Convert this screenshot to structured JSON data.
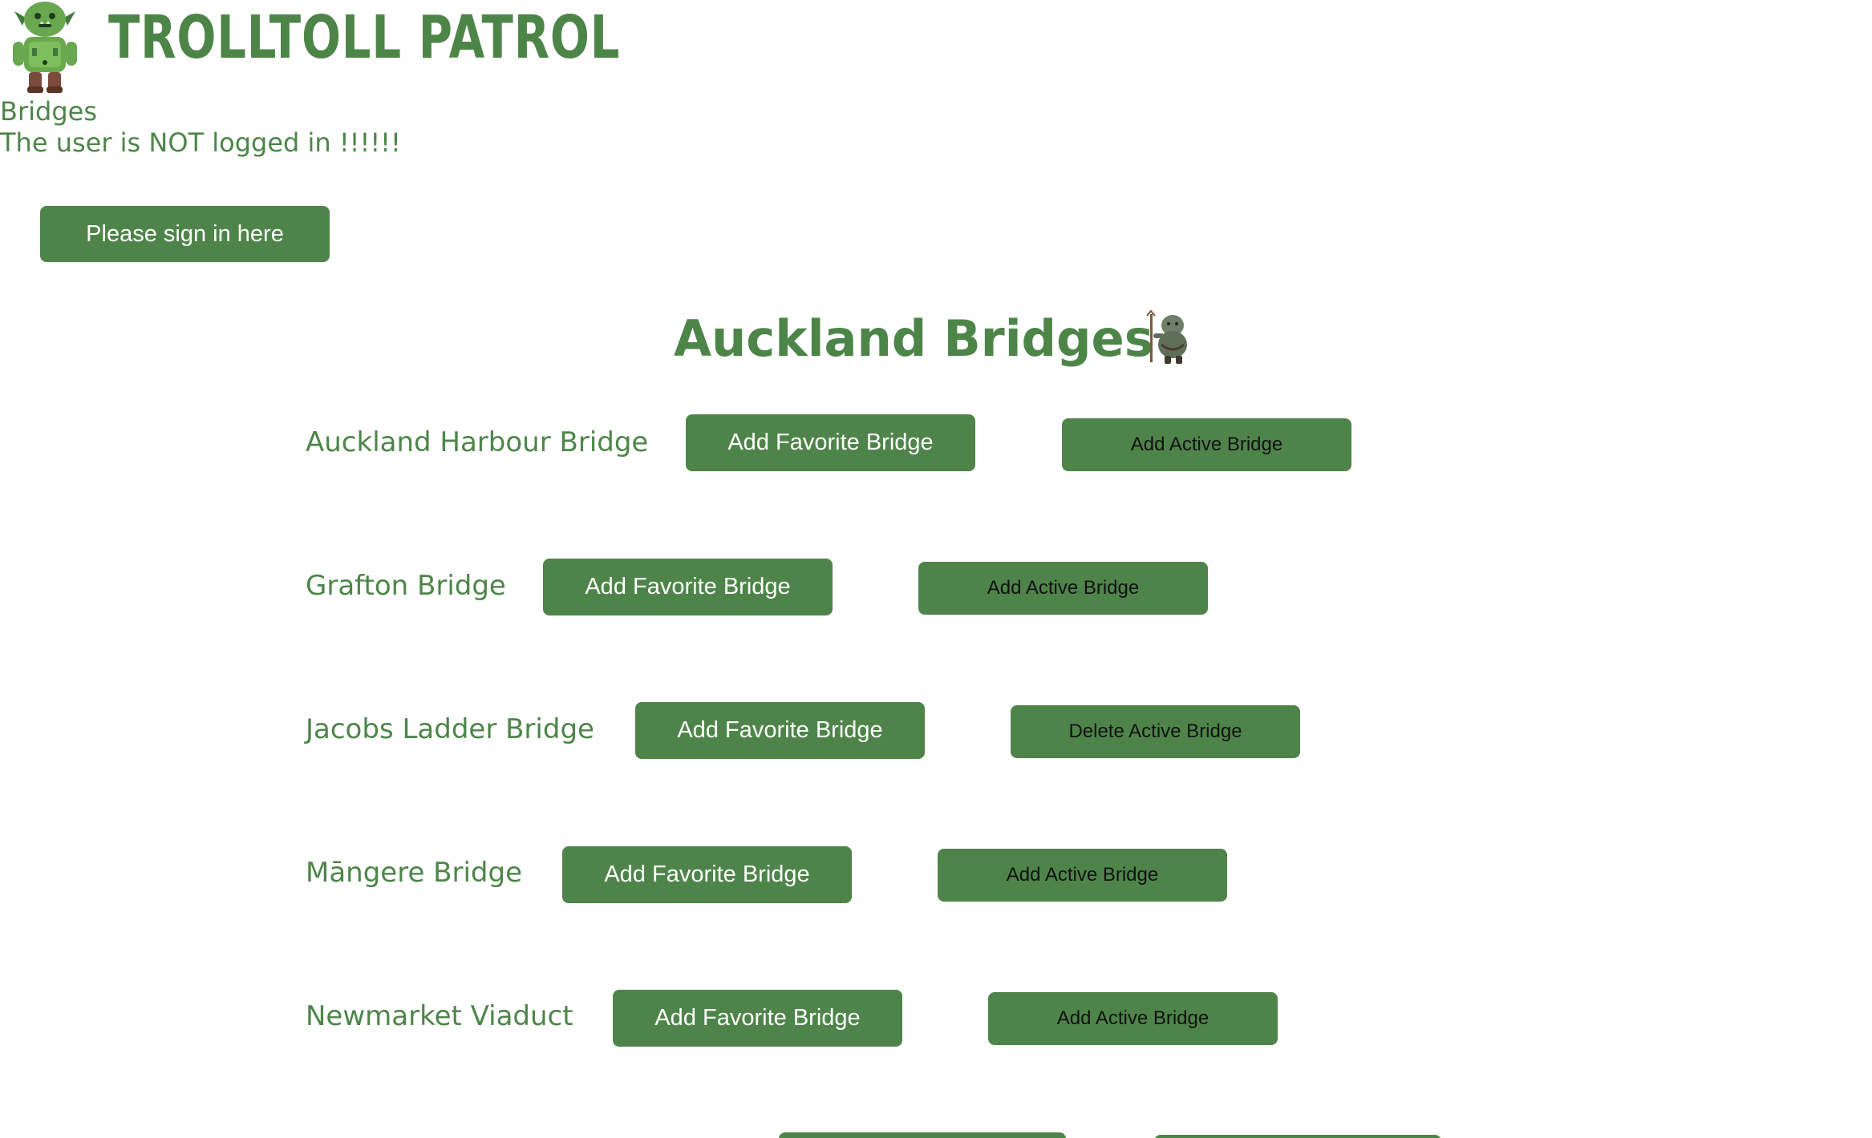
{
  "header": {
    "brand": "TROLLTOLL PATROL",
    "nav_label": "Bridges",
    "login_status": "The user is NOT logged in !!!!!!",
    "signin_label": "Please sign in here"
  },
  "main": {
    "title": "Auckland Bridges",
    "bridges": [
      {
        "name": "Auckland Harbour Bridge",
        "favorite_label": "Add Favorite Bridge",
        "active_label": "Add Active Bridge"
      },
      {
        "name": "Grafton Bridge",
        "favorite_label": "Add Favorite Bridge",
        "active_label": "Add Active Bridge"
      },
      {
        "name": "Jacobs Ladder Bridge",
        "favorite_label": "Add Favorite Bridge",
        "active_label": "Delete Active Bridge"
      },
      {
        "name": "Māngere Bridge",
        "favorite_label": "Add Favorite Bridge",
        "active_label": "Add Active Bridge"
      },
      {
        "name": "Newmarket Viaduct",
        "favorite_label": "Add Favorite Bridge",
        "active_label": "Add Active Bridge"
      }
    ]
  },
  "colors": {
    "accent": "#4e8449",
    "text": "#4d8549",
    "button_text_light": "#ffffff",
    "button_text_dark": "#111111"
  },
  "icons": {
    "logo": "troll-logo-icon",
    "heading": "troll-with-staff-icon"
  }
}
